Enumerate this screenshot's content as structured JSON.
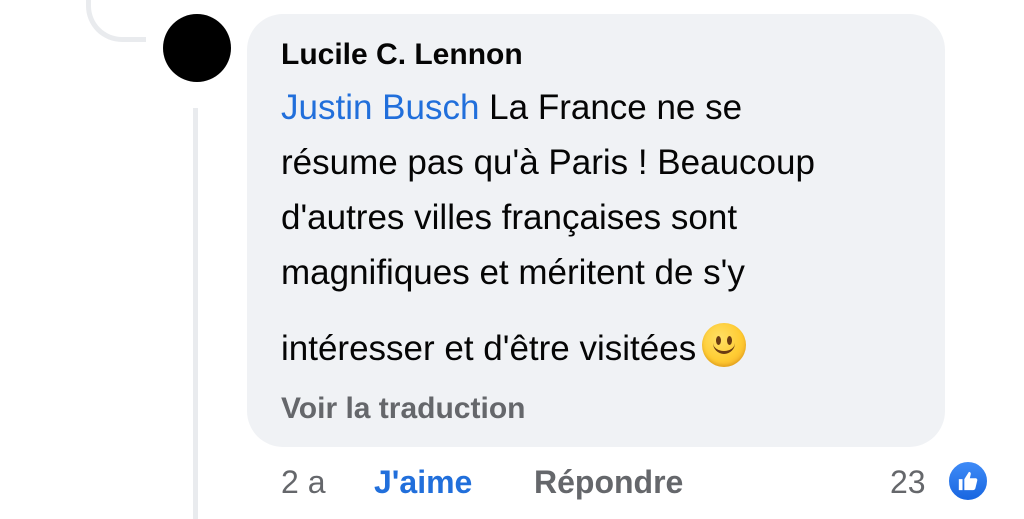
{
  "comment": {
    "author": "Lucile C. Lennon",
    "mention": "Justin Busch",
    "lines": [
      " La France ne se",
      "résume pas qu'à Paris ! Beaucoup",
      "d'autres villes françaises sont",
      "magnifiques et méritent de s'y",
      "intéresser et d'être visitées"
    ],
    "emoji": "slightly-smiling-face-icon",
    "translate_label": "Voir la traduction"
  },
  "actions": {
    "age": "2 a",
    "like_label": "J'aime",
    "reply_label": "Répondre",
    "like_count": "23",
    "like_icon": "thumbs-up-icon"
  },
  "colors": {
    "bubble": "#f0f2f5",
    "mention": "#216fdb",
    "secondary_text": "#65676b",
    "like_badge": "#1877f2"
  }
}
